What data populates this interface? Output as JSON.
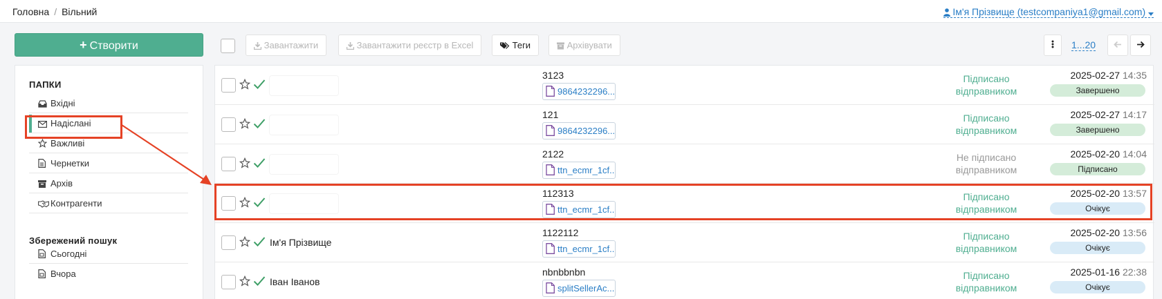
{
  "breadcrumb": {
    "home": "Головна",
    "separator": "/",
    "current": "Вільний"
  },
  "user": {
    "label": "Ім'я Прізвище (testcompaniya1@gmail.com)",
    "icon": "user-icon",
    "caret_icon": "caret-down-icon"
  },
  "create_button": {
    "label": "Створити",
    "icon": "plus-icon"
  },
  "sidebar": {
    "folders_heading": "ПАПКИ",
    "folders": [
      {
        "label": "Вхідні",
        "icon": "inbox-icon"
      },
      {
        "label": "Надіслані",
        "icon": "envelope-icon",
        "active": true
      },
      {
        "label": "Важливі",
        "icon": "star-icon"
      },
      {
        "label": "Чернетки",
        "icon": "file-icon"
      },
      {
        "label": "Архів",
        "icon": "archive-icon"
      },
      {
        "label": "Контрагенти",
        "icon": "handshake-icon"
      }
    ],
    "saved_heading": "Збережений пошук",
    "saved": [
      {
        "label": "Сьогодні",
        "icon": "calendar-file-icon"
      },
      {
        "label": "Вчора",
        "icon": "calendar-file-icon"
      }
    ]
  },
  "toolbar": {
    "download": "Завантажити",
    "download_excel": "Завантажити реєстр в Excel",
    "tags": "Теги",
    "archive": "Архівувати",
    "range": "1...20",
    "more_icon": "vertical-dots-icon",
    "prev_icon": "arrow-left-icon",
    "next_icon": "arrow-right-icon"
  },
  "documents": [
    {
      "sender": "",
      "number": "3123",
      "file": "9864232296...",
      "status_line1": "Підписано",
      "status_line2": "відправником",
      "status_color": "#4fae90",
      "date": "2025-02-27",
      "time": "14:35",
      "badge": "Завершено",
      "badge_kind": "done"
    },
    {
      "sender": "",
      "number": "121",
      "file": "9864232296...",
      "status_line1": "Підписано",
      "status_line2": "відправником",
      "status_color": "#4fae90",
      "date": "2025-02-27",
      "time": "14:17",
      "badge": "Завершено",
      "badge_kind": "done"
    },
    {
      "sender": "",
      "number": "2122",
      "file": "ttn_ecmr_1cf...",
      "status_line1": "Не підписано",
      "status_line2": "відправником",
      "status_color": "#999999",
      "date": "2025-02-20",
      "time": "14:04",
      "badge": "Підписано",
      "badge_kind": "signed"
    },
    {
      "sender": "",
      "number": "112313",
      "file": "ttn_ecmr_1cf...",
      "status_line1": "Підписано",
      "status_line2": "відправником",
      "status_color": "#4fae90",
      "date": "2025-02-20",
      "time": "13:57",
      "badge": "Очікує",
      "badge_kind": "wait"
    },
    {
      "sender": "Ім'я Прізвище",
      "number": "1122112",
      "file": "ttn_ecmr_1cf...",
      "status_line1": "Підписано",
      "status_line2": "відправником",
      "status_color": "#4fae90",
      "date": "2025-02-20",
      "time": "13:56",
      "badge": "Очікує",
      "badge_kind": "wait"
    },
    {
      "sender": "Іван Іванов",
      "number": "nbnbbnbn",
      "file": "splitSellerAc...",
      "status_line1": "Підписано",
      "status_line2": "відправником",
      "status_color": "#4fae90",
      "date": "2025-01-16",
      "time": "22:38",
      "badge": "Очікує",
      "badge_kind": "wait"
    }
  ],
  "colors": {
    "accent": "#4fae90",
    "link": "#2a7ec6",
    "callout": "#e54225"
  }
}
